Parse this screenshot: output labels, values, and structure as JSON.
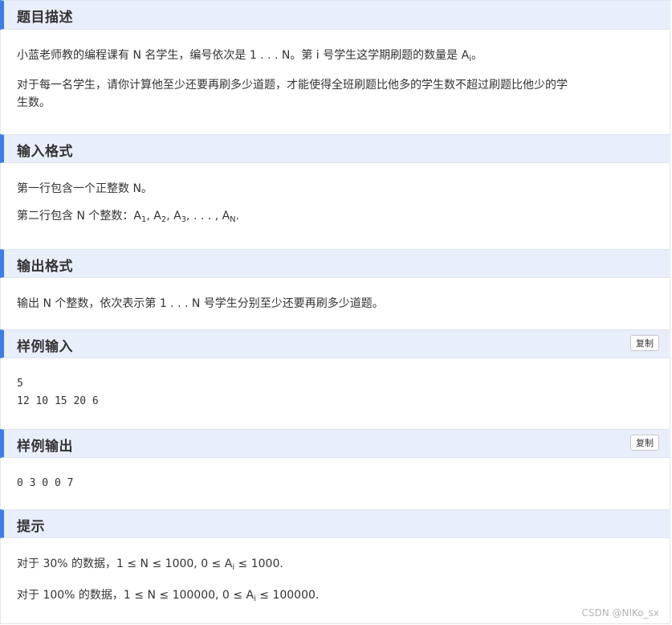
{
  "sections": {
    "description": {
      "title": "题目描述",
      "p1_prefix": "小蓝老师教的编程课有 N 名学生，编号依次是 1 . . . N。第 i 号学生这学期刷题的数量是 A",
      "p1_sub": "i",
      "p1_suffix": "。",
      "p2_line1": "对于每一名学生，请你计算他至少还要再刷多少道题，才能使得全班刷题比他多的学生数不超过刷题比他少的学",
      "p2_line2": "生数。"
    },
    "input_format": {
      "title": "输入格式",
      "line1": "第一行包含一个正整数 N。",
      "line2_prefix": "第二行包含 N 个整数：",
      "a1": "A",
      "a1_sub": "1",
      "sep1": ", ",
      "a2": "A",
      "a2_sub": "2",
      "sep2": ", ",
      "a3": "A",
      "a3_sub": "3",
      "sep3": ", . . . , ",
      "an": "A",
      "an_sub": "N",
      "end": "."
    },
    "output_format": {
      "title": "输出格式",
      "line1": "输出 N 个整数，依次表示第 1 . . . N 号学生分别至少还要再刷多少道题。"
    },
    "sample_input": {
      "title": "样例输入",
      "copy_label": "复制",
      "line1": "5",
      "line2": "12 10 15 20 6"
    },
    "sample_output": {
      "title": "样例输出",
      "copy_label": "复制",
      "line1": "0 3 0 0 7"
    },
    "hint": {
      "title": "提示",
      "line1_prefix": "对于 30% 的数据，1 ≤ N ≤ 1000, 0 ≤ A",
      "line1_sub": "i",
      "line1_suffix": " ≤ 1000.",
      "line2_prefix": "对于 100% 的数据，1 ≤ N ≤ 100000, 0 ≤ A",
      "line2_sub": "i",
      "line2_suffix": " ≤ 100000."
    }
  },
  "watermark": "CSDN @NIKo_sx",
  "colors": {
    "header_bg": "#e8eefa",
    "header_accent": "#3f7de0"
  }
}
